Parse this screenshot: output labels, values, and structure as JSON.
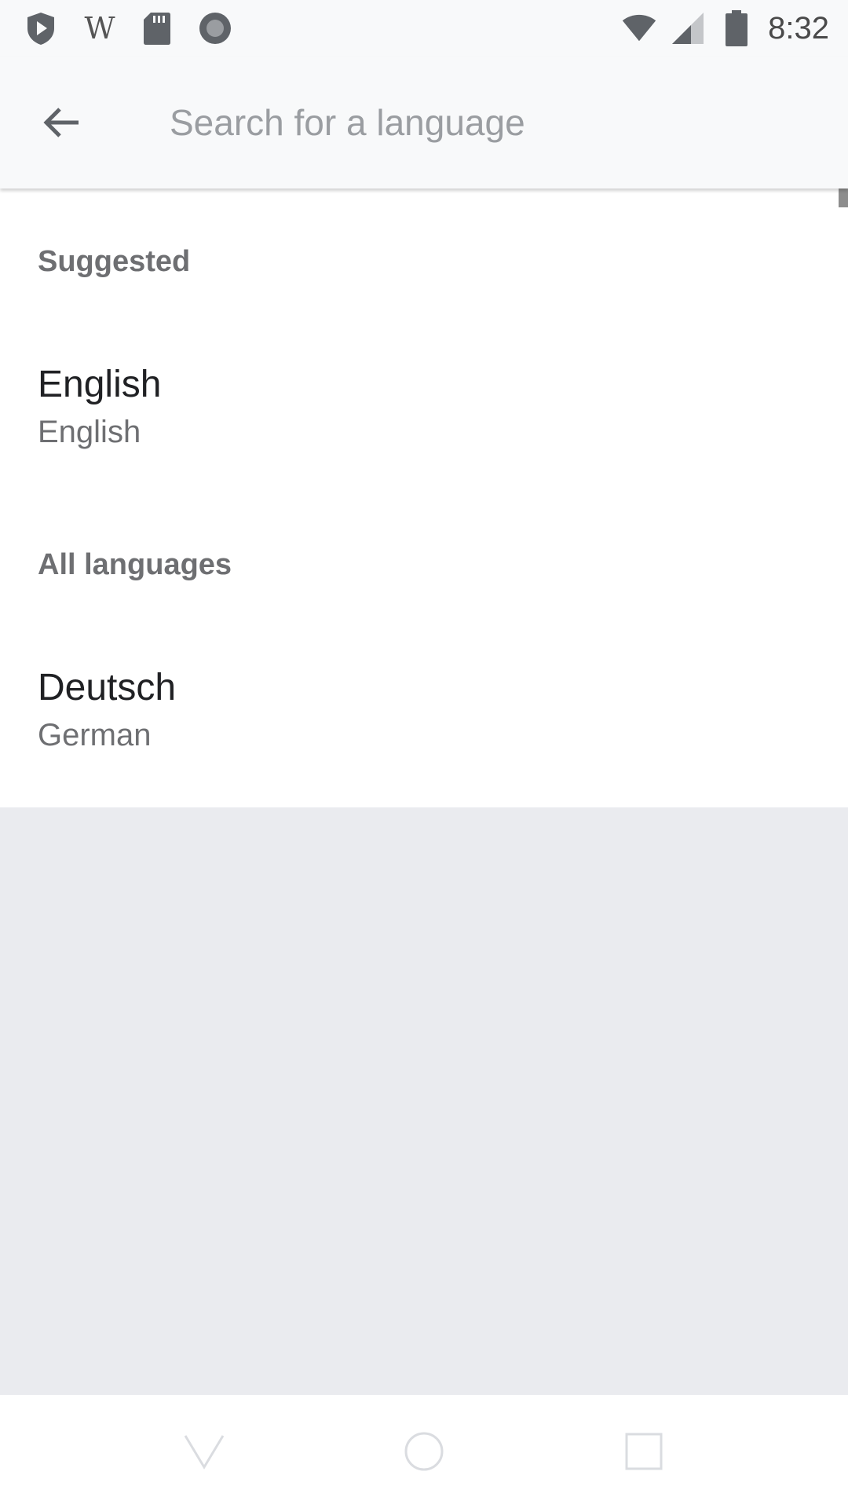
{
  "status_bar": {
    "left_icons": [
      "shield-play-icon",
      "wikipedia-w-icon",
      "sd-card-icon",
      "record-circle-icon"
    ],
    "wiki_glyph": "W",
    "right_icons": [
      "wifi-icon",
      "cell-signal-icon",
      "battery-icon"
    ],
    "time": "8:32"
  },
  "toolbar": {
    "back_icon": "arrow-back-icon",
    "search_placeholder": "Search for a language",
    "search_value": ""
  },
  "list": {
    "suggested_header": "Suggested",
    "suggested_items": [
      {
        "name": "English",
        "translation": "English"
      }
    ],
    "all_header": "All languages",
    "all_items": [
      {
        "name": "Deutsch",
        "translation": "German"
      }
    ]
  },
  "nav_bar": {
    "icons": [
      "back-nav-icon",
      "home-nav-icon",
      "recents-nav-icon"
    ]
  },
  "colors": {
    "bar_background": "#f8f9fa",
    "empty_background": "#eaebef",
    "primary_text": "#202124",
    "secondary_text": "#6e6f72"
  }
}
